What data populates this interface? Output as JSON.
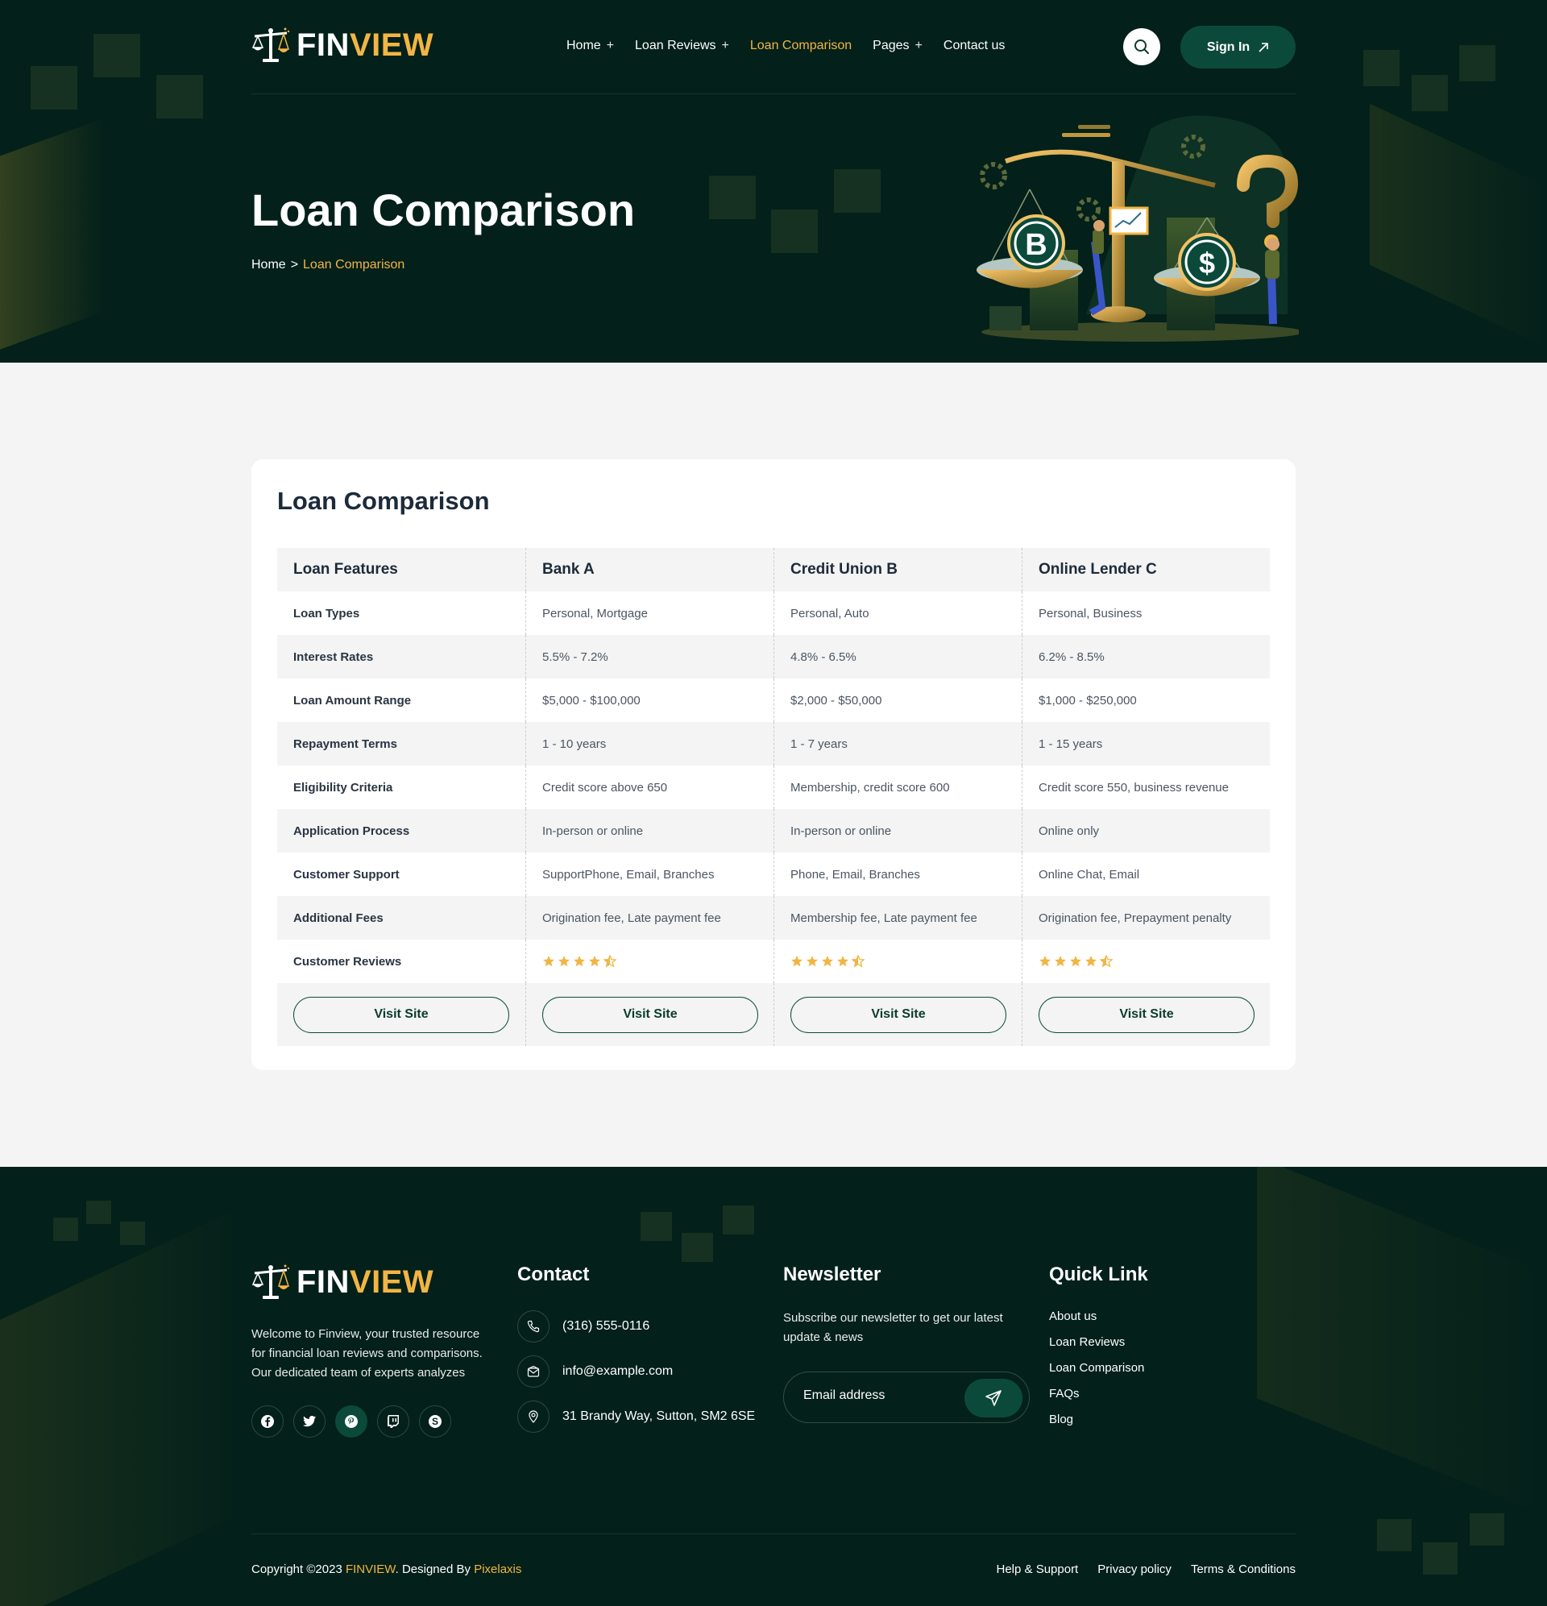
{
  "brand": {
    "part1": "FIN",
    "part2": "VIEW",
    "accent": "#f2b544",
    "dark": "#03201a",
    "green": "#0b4a3b"
  },
  "nav": {
    "items": [
      {
        "label": "Home",
        "has_sub": true,
        "active": false
      },
      {
        "label": "Loan Reviews",
        "has_sub": true,
        "active": false
      },
      {
        "label": "Loan Comparison",
        "has_sub": false,
        "active": true
      },
      {
        "label": "Pages",
        "has_sub": true,
        "active": false
      },
      {
        "label": "Contact us",
        "has_sub": false,
        "active": false
      }
    ],
    "plus": "+",
    "signin_label": "Sign In"
  },
  "hero": {
    "title": "Loan Comparison",
    "breadcrumb": {
      "home": "Home",
      "sep": ">",
      "current": "Loan Comparison"
    }
  },
  "comparison": {
    "title": "Loan Comparison",
    "headers": [
      "Loan Features",
      "Bank A",
      "Credit Union B",
      "Online Lender C"
    ],
    "rows": [
      [
        "Loan Types",
        "Personal, Mortgage",
        "Personal, Auto",
        "Personal, Business"
      ],
      [
        "Interest Rates",
        "5.5% - 7.2%",
        "4.8% - 6.5%",
        "6.2% - 8.5%"
      ],
      [
        "Loan Amount Range",
        "$5,000 - $100,000",
        "$2,000 - $50,000",
        "$1,000 - $250,000"
      ],
      [
        "Repayment Terms",
        "1 - 10 years",
        "1 - 7 years",
        "1 - 15 years"
      ],
      [
        "Eligibility Criteria",
        "Credit score above 650",
        "Membership, credit score 600",
        "Credit score 550, business revenue"
      ],
      [
        "Application Process",
        "In-person or online",
        "In-person or online",
        "Online only"
      ],
      [
        "Customer Support",
        "SupportPhone, Email, Branches",
        "Phone, Email, Branches",
        "Online Chat, Email"
      ],
      [
        "Additional Fees",
        "Origination fee, Late payment fee",
        "Membership fee, Late payment fee",
        "Origination fee, Prepayment penalty"
      ]
    ],
    "reviews_label": "Customer Reviews",
    "ratings": [
      4.5,
      4.5,
      4.5
    ],
    "visit_label": "Visit Site"
  },
  "footer": {
    "about": "Welcome to Finview, your trusted resource for financial loan reviews and comparisons. Our dedicated team of experts analyzes",
    "socials": [
      "facebook-icon",
      "twitter-icon",
      "pinterest-icon",
      "twitch-icon",
      "skype-icon"
    ],
    "contact": {
      "heading": "Contact",
      "phone": "(316) 555-0116",
      "email": "info@example.com",
      "address": "31 Brandy Way, Sutton, SM2 6SE"
    },
    "newsletter": {
      "heading": "Newsletter",
      "text": "Subscribe our newsletter to get our latest update & news",
      "placeholder": "Email address"
    },
    "quick_links": {
      "heading": "Quick Link",
      "items": [
        "About us",
        "Loan Reviews",
        "Loan Comparison",
        "FAQs",
        "Blog"
      ]
    },
    "copyright": {
      "prefix": "Copyright ©2023 ",
      "brand": "FINVIEW",
      "mid": ". Designed By ",
      "designer": "Pixelaxis"
    },
    "legal": [
      "Help & Support",
      "Privacy policy",
      "Terms & Conditions"
    ]
  }
}
